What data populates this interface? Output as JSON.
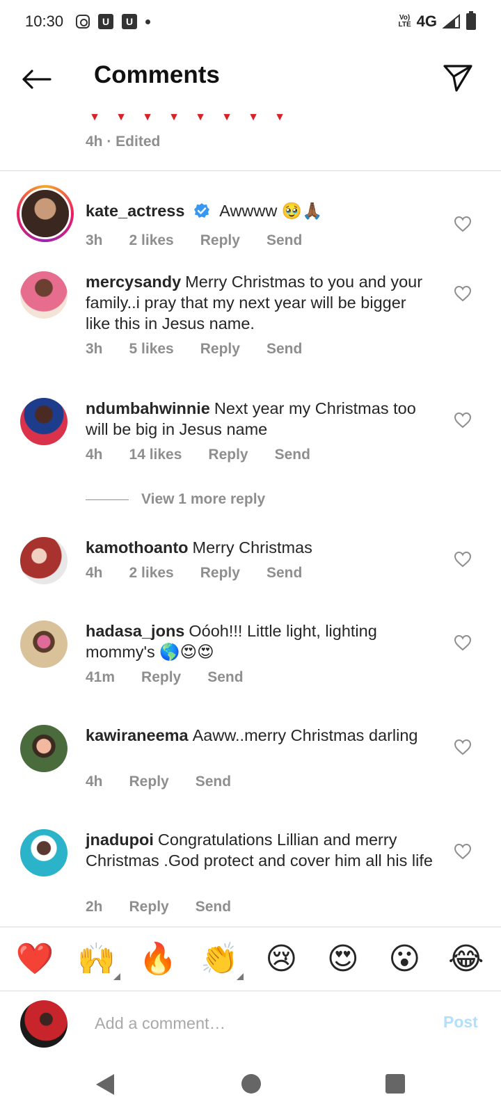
{
  "status_bar": {
    "time": "10:30",
    "volte": "Vo) LTE",
    "network": "4G",
    "icons": [
      "instagram-icon",
      "u-app-icon",
      "u-app-icon",
      "notification-dot-icon",
      "signal-icon",
      "battery-icon"
    ]
  },
  "header": {
    "title": "Comments",
    "back_icon": "arrow-left-icon",
    "share_icon": "paper-plane-icon"
  },
  "caption": {
    "meta": "4h · Edited"
  },
  "comments": [
    {
      "username": "kate_actress",
      "verified": true,
      "text": "Awwww 🥹🙏🏾",
      "time": "3h",
      "likes": "2 likes",
      "reply": "Reply",
      "send": "Send",
      "avatar_color": "#6b4a3a"
    },
    {
      "username": "mercysandy",
      "text": "Merry Christmas to you and your family..i pray that my next year will be bigger like this in Jesus name.",
      "time": "3h",
      "likes": "5 likes",
      "reply": "Reply",
      "send": "Send",
      "avatar_color": "#e76d8f"
    },
    {
      "username": "ndumbahwinnie",
      "text": "Next year my Christmas too will be big in Jesus name",
      "time": "4h",
      "likes": "14 likes",
      "reply": "Reply",
      "send": "Send",
      "avatar_color": "#d9324a",
      "view_more": "View 1 more reply"
    },
    {
      "username": "kamothoanto",
      "text": "Merry Christmas",
      "time": "4h",
      "likes": "2 likes",
      "reply": "Reply",
      "send": "Send",
      "avatar_color": "#a8332e"
    },
    {
      "username": "hadasa_jons",
      "text": "Oóoh!!! Little light, lighting mommy's 🌎😍😍",
      "time": "41m",
      "reply": "Reply",
      "send": "Send",
      "avatar_color": "#b79a6e"
    },
    {
      "username": "kawiraneema",
      "text": "Aaww..merry Christmas darling",
      "time": "4h",
      "reply": "Reply",
      "send": "Send",
      "avatar_color": "#4a6b3c"
    },
    {
      "username": "jnadupoi",
      "text": "Congratulations Lillian and merry Christmas .God protect and cover him all his life",
      "time": "2h",
      "reply": "Reply",
      "send": "Send",
      "avatar_color": "#2bb3c9"
    }
  ],
  "emoji_bar": [
    "❤️",
    "🙌",
    "🔥",
    "👏",
    "😢",
    "😍",
    "😮",
    "😂"
  ],
  "composer": {
    "placeholder": "Add a comment…",
    "post_label": "Post",
    "avatar_color": "#c8242b"
  },
  "colors": {
    "verified_blue": "#3897f0",
    "muted_text": "#8e8e8e",
    "post_disabled": "#b2dffc"
  }
}
